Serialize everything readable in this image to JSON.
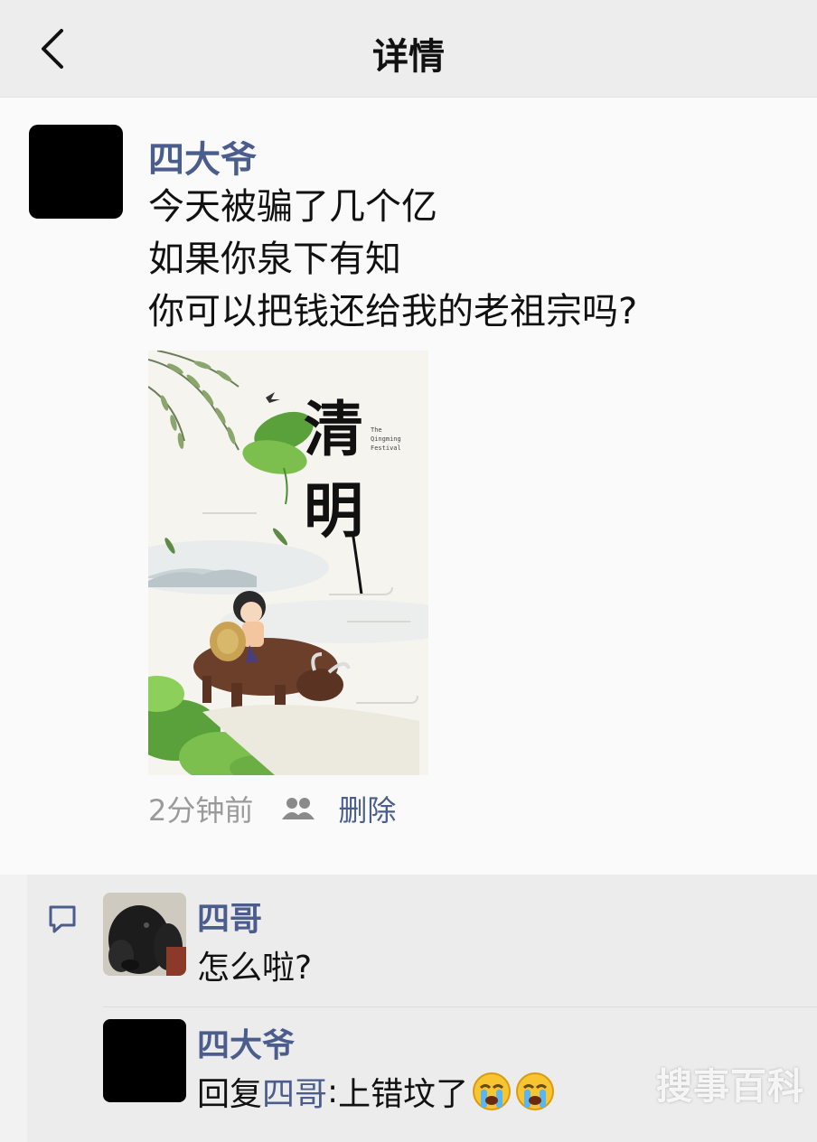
{
  "header": {
    "title": "详情"
  },
  "post": {
    "author": "四大爷",
    "lines": [
      "今天被骗了几个亿",
      "如果你泉下有知",
      "你可以把钱还给我的老祖宗吗?"
    ],
    "image": {
      "title_text": "清明",
      "subtitle": "The Qingming Festival"
    },
    "time": "2分钟前",
    "delete_label": "删除"
  },
  "comments": [
    {
      "name": "四哥",
      "text": "怎么啦?"
    },
    {
      "name": "四大爷",
      "reply_prefix": "回复",
      "reply_to": "四哥",
      "reply_colon": ": ",
      "text": "上错坟了"
    }
  ],
  "watermark": "搜事百科"
}
